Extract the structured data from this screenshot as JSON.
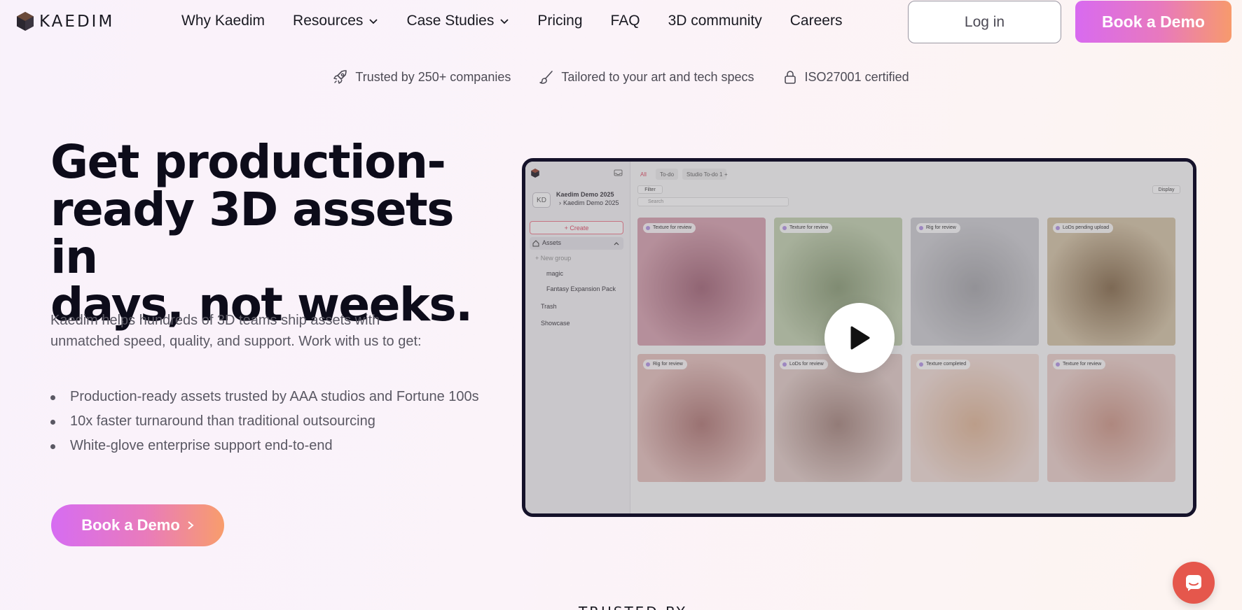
{
  "brand": {
    "name": "KAEDIM"
  },
  "nav": {
    "links": [
      "Why Kaedim",
      "Resources",
      "Case Studies",
      "Pricing",
      "FAQ",
      "3D community",
      "Careers"
    ],
    "login_label": "Log in",
    "demo_label": "Book a Demo"
  },
  "trust": [
    {
      "icon": "rocket-icon",
      "text": "Trusted by 250+ companies"
    },
    {
      "icon": "brush-icon",
      "text": "Tailored to your art and tech specs"
    },
    {
      "icon": "lock-icon",
      "text": "ISO27001 certified"
    }
  ],
  "hero": {
    "title_lines": [
      "Get production-",
      "ready 3D assets in",
      "days, not weeks."
    ],
    "description": "Kaedim helps hundreds of 3D teams ship assets with unmatched speed, quality, and support. Work with us to get:",
    "bullets": [
      "Production-ready assets trusted by AAA studios and Fortune 100s",
      "10x faster turnaround than traditional outsourcing",
      "White-glove enterprise support end-to-end"
    ],
    "cta_label": "Book a Demo"
  },
  "preview": {
    "workspace_title": "Kaedim Demo 2025",
    "workspace_sub": "Kaedim Demo 2025",
    "avatar": "KD",
    "create_label": "+ Create",
    "assets_label": "Assets",
    "new_group_label": "+ New group",
    "groups": [
      "magic",
      "Fantasy Expansion Pack"
    ],
    "trash_label": "Trash",
    "showcase_label": "Showcase",
    "tabs": [
      "All",
      "To-do",
      "Studio To-do 1",
      "+"
    ],
    "filter_label": "Filter",
    "search_placeholder": "Search",
    "display_label": "Display",
    "cards": [
      {
        "badge": "Texture for review",
        "c1": "#d9a6b3",
        "c2": "#a66b7c"
      },
      {
        "badge": "Texture for review",
        "c1": "#c5d3b3",
        "c2": "#8fa07b"
      },
      {
        "badge": "Rig for review",
        "c1": "#cfcfd3",
        "c2": "#a9a9ad"
      },
      {
        "badge": "LoDs pending upload",
        "c1": "#d6c6a9",
        "c2": "#8b7152"
      },
      {
        "badge": "Rig for review",
        "c1": "#e7c4c0",
        "c2": "#b37d7a"
      },
      {
        "badge": "LoDs for review",
        "c1": "#e3cec9",
        "c2": "#a98a82"
      },
      {
        "badge": "Texture completed",
        "c1": "#f2ded7",
        "c2": "#e1b99b"
      },
      {
        "badge": "Texture for review",
        "c1": "#ecd2cc",
        "c2": "#cf9b8c"
      }
    ]
  },
  "footer": {
    "trusted_by": "TRUSTED BY"
  }
}
